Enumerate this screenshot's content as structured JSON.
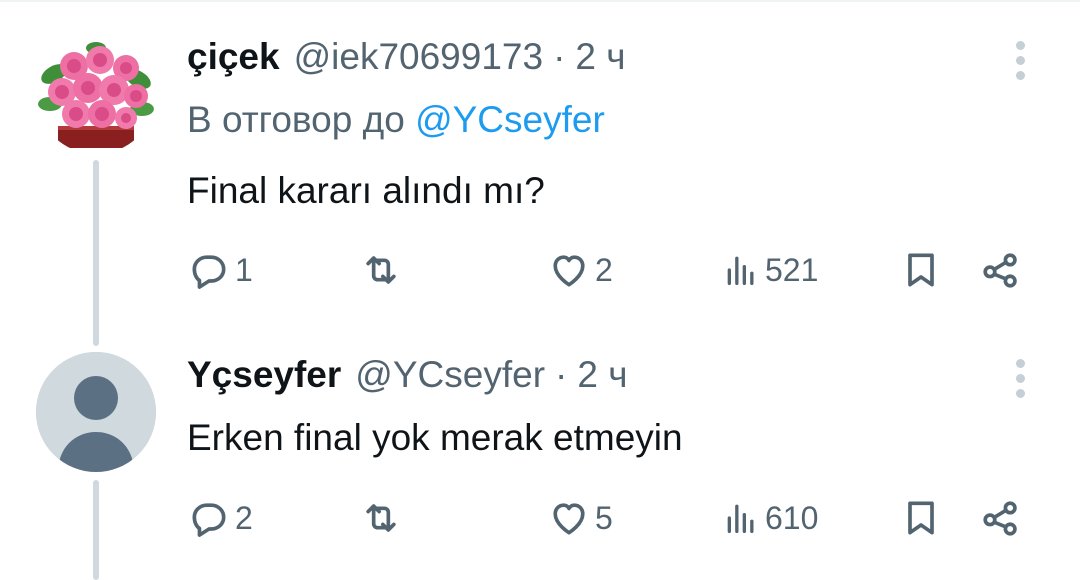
{
  "tweets": [
    {
      "display_name": "çiçek",
      "handle": "@iek70699173",
      "separator": "·",
      "timestamp": "2 ч",
      "reply_prefix": "В отговор до",
      "reply_to": "@YCseyfer",
      "text": "Final kararı alındı mı?",
      "avatar": "rose-bouquet-avatar",
      "stats": {
        "replies": "1",
        "retweets": "",
        "likes": "2",
        "views": "521"
      }
    },
    {
      "display_name": "Yçseyfer",
      "handle": "@YCseyfer",
      "separator": "·",
      "timestamp": "2 ч",
      "text": "Erken final yok merak etmeyin",
      "avatar": "default-profile-avatar",
      "stats": {
        "replies": "2",
        "retweets": "",
        "likes": "5",
        "views": "610"
      }
    }
  ],
  "icons": [
    "reply-icon",
    "retweet-icon",
    "like-icon",
    "views-icon",
    "bookmark-icon",
    "share-icon",
    "more-icon"
  ],
  "colors": {
    "text_primary": "#0f1419",
    "text_secondary": "#536471",
    "link": "#1d9bf0",
    "thread_line": "#cfd9de",
    "default_avatar_bg": "#cfd9de",
    "default_avatar_fg": "#5b7083"
  }
}
